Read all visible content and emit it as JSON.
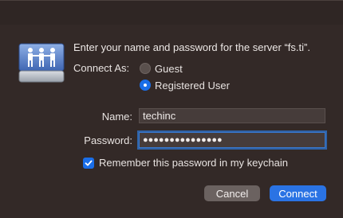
{
  "dialog": {
    "prompt": "Enter your name and password for the server “fs.ti”.",
    "connect_as_label": "Connect As:",
    "options": [
      {
        "label": "Guest",
        "selected": false
      },
      {
        "label": "Registered User",
        "selected": true
      }
    ],
    "name_label": "Name:",
    "name_value": "techinc",
    "password_label": "Password:",
    "password_value": "●●●●●●●●●●●●●●●",
    "remember_label": "Remember this password in my keychain",
    "remember_checked": true,
    "cancel_label": "Cancel",
    "connect_label": "Connect"
  },
  "icons": {
    "server": "shared-server-icon",
    "checkmark": "checkmark-icon"
  },
  "colors": {
    "background": "#332927",
    "accent": "#1a6ee8",
    "field_bg": "#463c3a",
    "cancel_bg": "#6b6260"
  }
}
